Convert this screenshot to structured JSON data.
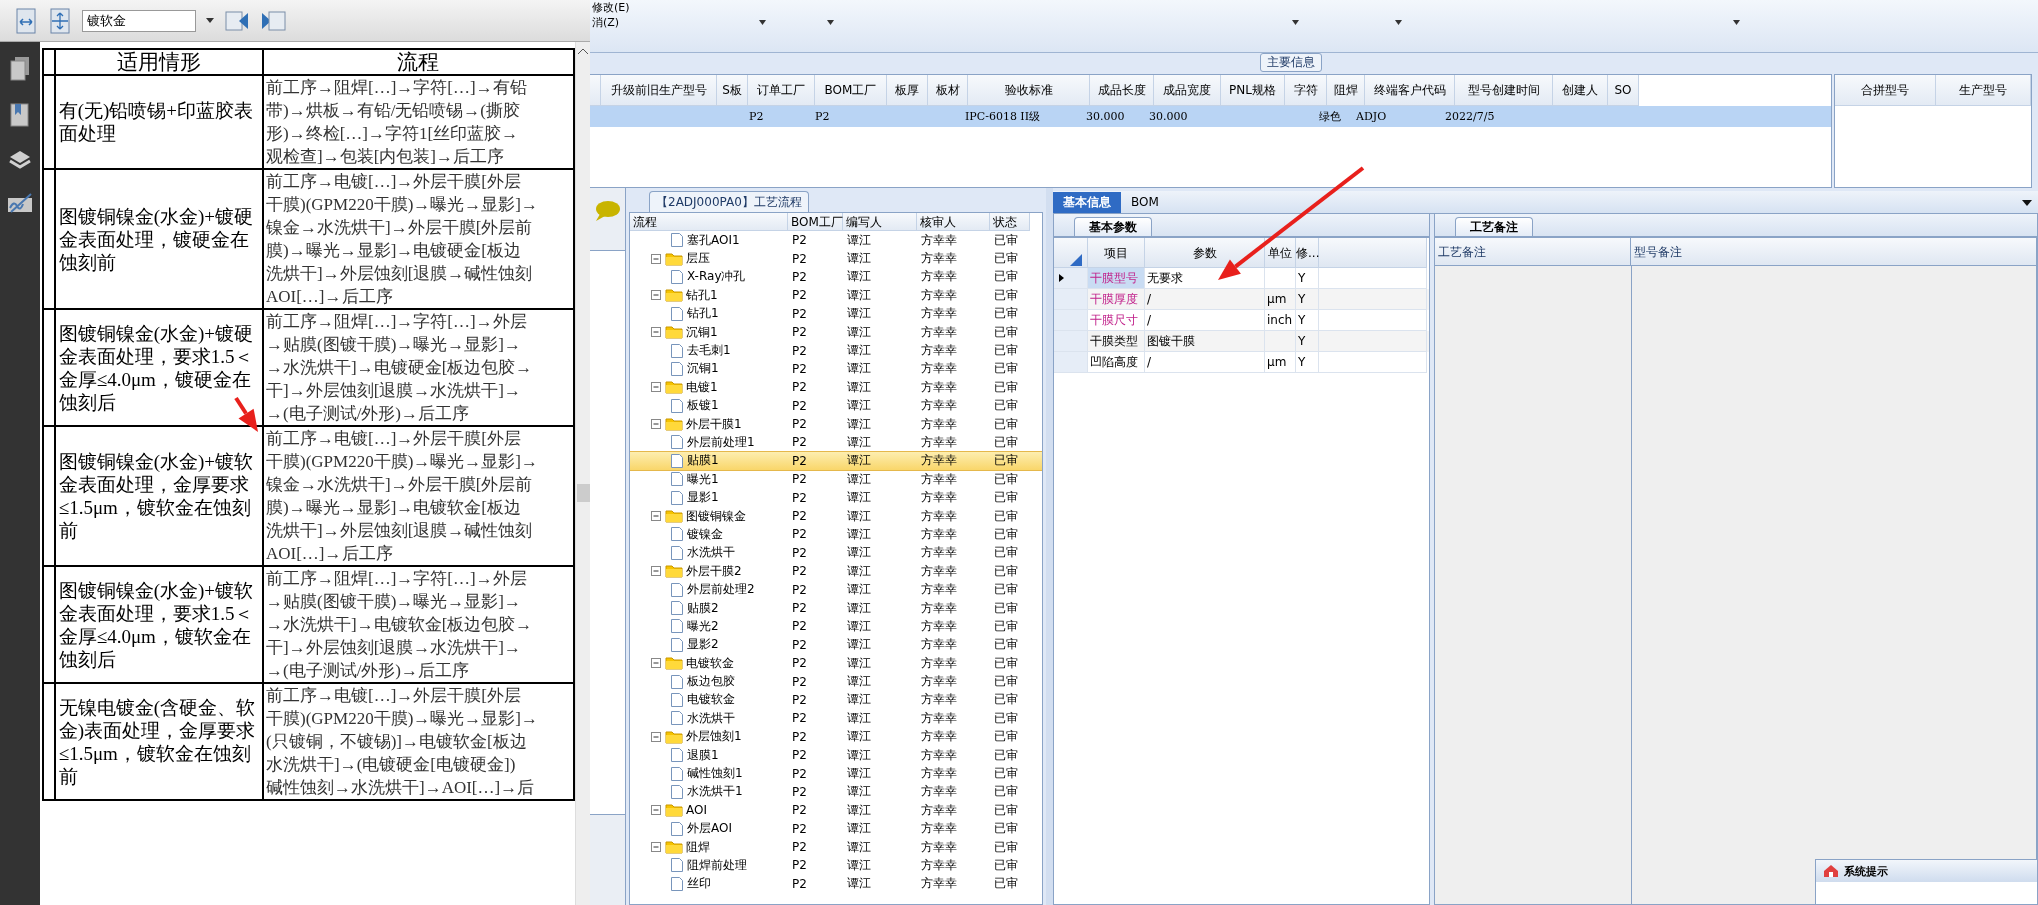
{
  "doc_viewer": {
    "zoom_field": {
      "value": "镀软金"
    },
    "table": {
      "columns": [
        "适用情形",
        "流程"
      ],
      "rows": [
        {
          "case": "有(无)铅喷锡+印蓝胶表面处理",
          "flow": [
            "前工序→阻焊[…]→字符[…]→有铅",
            "带)→烘板→有铅/无铅喷锡→(撕胶",
            "形)→终检[…]→字符1[丝印蓝胶→",
            "观检查]→包装[内包装]→后工序"
          ]
        },
        {
          "case": "图镀铜镍金(水金)+镀硬金表面处理，镀硬金在蚀刻前",
          "flow": [
            "前工序→电镀[…]→外层干膜[外层",
            "干膜)(GPM220干膜)→曝光→显影]→",
            "镍金→水洗烘干]→外层干膜[外层前",
            "膜)→曝光→显影]→电镀硬金[板边",
            "洗烘干]→外层蚀刻[退膜→碱性蚀刻",
            "AOI[…]→后工序"
          ]
        },
        {
          "case": "图镀铜镍金(水金)+镀硬金表面处理，要求1.5＜金厚≤4.0μm，镀硬金在蚀刻后",
          "flow": [
            "前工序→阻焊[…]→字符[…]→外层",
            "→贴膜(图镀干膜)→曝光→显影]→",
            "→水洗烘干]→电镀硬金[板边包胶→",
            "干]→外层蚀刻[退膜→水洗烘干]→",
            "→(电子测试/外形)→后工序"
          ]
        },
        {
          "case": "图镀铜镍金(水金)+镀软金表面处理，金厚要求≤1.5μm，镀软金在蚀刻前",
          "flow": [
            "前工序→电镀[…]→外层干膜[外层",
            "干膜)(GPM220干膜)→曝光→显影]→",
            "镍金→水洗烘干]→外层干膜[外层前",
            "膜)→曝光→显影]→电镀软金[板边",
            "洗烘干]→外层蚀刻[退膜→碱性蚀刻",
            "AOI[…]→后工序"
          ]
        },
        {
          "case": "图镀铜镍金(水金)+镀软金表面处理，要求1.5＜金厚≤4.0μm，镀软金在蚀刻后",
          "flow": [
            "前工序→阻焊[…]→字符[…]→外层",
            "→贴膜(图镀干膜)→曝光→显影]→",
            "→水洗烘干]→电镀软金[板边包胶→",
            "干]→外层蚀刻[退膜→水洗烘干]→",
            "→(电子测试/外形)→后工序"
          ]
        },
        {
          "case": "无镍电镀金(含硬金、软金)表面处理，金厚要求≤1.5μm，镀软金在蚀刻前",
          "flow": [
            "前工序→电镀[…]→外层干膜[外层",
            "干膜)(GPM220干膜)→曝光→显影]→",
            "(只镀铜，不镀锡)]→电镀软金[板边",
            "水洗烘干]→(电镀硬金[电镀硬金])",
            "碱性蚀刻→水洗烘干]→AOI[…]→后"
          ]
        }
      ]
    }
  },
  "menu": {
    "items": [
      "修改(E)",
      "消(Z)"
    ]
  },
  "main_info": {
    "title": "主要信息",
    "columns": [
      "升级前旧生产型号",
      "S板",
      "订单工厂",
      "BOM工厂",
      "板厚",
      "板材",
      "验收标准",
      "成品长度",
      "成品宽度",
      "PNL规格",
      "字符",
      "阻焊",
      "终端客户代码",
      "型号创建时间",
      "创建人",
      "SO"
    ],
    "rows": [
      {
        "selected": true,
        "cells": [
          {},
          {},
          {
            "text": "P2"
          },
          {
            "text": "P2"
          },
          {},
          {},
          {
            "text": "IPC-6018 II级"
          },
          {
            "text": "30.000"
          },
          {
            "text": "30.000"
          },
          {},
          {},
          {
            "text": "绿色"
          },
          {
            "text": "ADJO"
          },
          {
            "text": "2022/7/5"
          },
          {},
          {}
        ]
      }
    ],
    "side_columns": [
      "合拼型号",
      "生产型号"
    ]
  },
  "process_flow": {
    "title": "【2ADJ000PA0】工艺流程",
    "columns": [
      "流程",
      "BOM工厂",
      "编写人",
      "核审人",
      "状态"
    ],
    "tree": [
      {
        "label": "塞孔AOI1",
        "kind": "file",
        "selected": false,
        "cells": [
          "P2",
          "谭江",
          "方幸幸",
          "已审"
        ]
      },
      {
        "label": "层压",
        "kind": "folder",
        "expanded": true,
        "selected": false,
        "cells": [
          "P2",
          "谭江",
          "方幸幸",
          "已审"
        ],
        "children": [
          {
            "label": "X-Ray冲孔",
            "kind": "file",
            "selected": false,
            "cells": [
              "P2",
              "谭江",
              "方幸幸",
              "已审"
            ]
          }
        ]
      },
      {
        "label": "钻孔1",
        "kind": "folder",
        "expanded": true,
        "selected": false,
        "cells": [
          "P2",
          "谭江",
          "方幸幸",
          "已审"
        ],
        "children": [
          {
            "label": "钻孔1",
            "kind": "file",
            "selected": false,
            "cells": [
              "P2",
              "谭江",
              "方幸幸",
              "已审"
            ]
          }
        ]
      },
      {
        "label": "沉铜1",
        "kind": "folder",
        "expanded": true,
        "selected": false,
        "cells": [
          "P2",
          "谭江",
          "方幸幸",
          "已审"
        ],
        "children": [
          {
            "label": "去毛刺1",
            "kind": "file",
            "selected": false,
            "cells": [
              "P2",
              "谭江",
              "方幸幸",
              "已审"
            ]
          },
          {
            "label": "沉铜1",
            "kind": "file",
            "selected": false,
            "cells": [
              "P2",
              "谭江",
              "方幸幸",
              "已审"
            ]
          }
        ]
      },
      {
        "label": "电镀1",
        "kind": "folder",
        "expanded": true,
        "selected": false,
        "cells": [
          "P2",
          "谭江",
          "方幸幸",
          "已审"
        ],
        "children": [
          {
            "label": "板镀1",
            "kind": "file",
            "selected": false,
            "cells": [
              "P2",
              "谭江",
              "方幸幸",
              "已审"
            ]
          }
        ]
      },
      {
        "label": "外层干膜1",
        "kind": "folder",
        "expanded": true,
        "selected": false,
        "cells": [
          "P2",
          "谭江",
          "方幸幸",
          "已审"
        ],
        "children": [
          {
            "label": "外层前处理1",
            "kind": "file",
            "selected": false,
            "cells": [
              "P2",
              "谭江",
              "方幸幸",
              "已审"
            ]
          },
          {
            "label": "贴膜1",
            "kind": "file",
            "selected": true,
            "cells": [
              "P2",
              "谭江",
              "方幸幸",
              "已审"
            ]
          },
          {
            "label": "曝光1",
            "kind": "file",
            "selected": false,
            "cells": [
              "P2",
              "谭江",
              "方幸幸",
              "已审"
            ]
          },
          {
            "label": "显影1",
            "kind": "file",
            "selected": false,
            "cells": [
              "P2",
              "谭江",
              "方幸幸",
              "已审"
            ]
          }
        ]
      },
      {
        "label": "图镀铜镍金",
        "kind": "folder",
        "expanded": true,
        "selected": false,
        "cells": [
          "P2",
          "谭江",
          "方幸幸",
          "已审"
        ],
        "children": [
          {
            "label": "镀镍金",
            "kind": "file",
            "selected": false,
            "cells": [
              "P2",
              "谭江",
              "方幸幸",
              "已审"
            ]
          },
          {
            "label": "水洗烘干",
            "kind": "file",
            "selected": false,
            "cells": [
              "P2",
              "谭江",
              "方幸幸",
              "已审"
            ]
          }
        ]
      },
      {
        "label": "外层干膜2",
        "kind": "folder",
        "expanded": true,
        "selected": false,
        "cells": [
          "P2",
          "谭江",
          "方幸幸",
          "已审"
        ],
        "children": [
          {
            "label": "外层前处理2",
            "kind": "file",
            "selected": false,
            "cells": [
              "P2",
              "谭江",
              "方幸幸",
              "已审"
            ]
          },
          {
            "label": "贴膜2",
            "kind": "file",
            "selected": false,
            "cells": [
              "P2",
              "谭江",
              "方幸幸",
              "已审"
            ]
          },
          {
            "label": "曝光2",
            "kind": "file",
            "selected": false,
            "cells": [
              "P2",
              "谭江",
              "方幸幸",
              "已审"
            ]
          },
          {
            "label": "显影2",
            "kind": "file",
            "selected": false,
            "cells": [
              "P2",
              "谭江",
              "方幸幸",
              "已审"
            ]
          }
        ]
      },
      {
        "label": "电镀软金",
        "kind": "folder",
        "expanded": true,
        "selected": false,
        "cells": [
          "P2",
          "谭江",
          "方幸幸",
          "已审"
        ],
        "children": [
          {
            "label": "板边包胶",
            "kind": "file",
            "selected": false,
            "cells": [
              "P2",
              "谭江",
              "方幸幸",
              "已审"
            ]
          },
          {
            "label": "电镀软金",
            "kind": "file",
            "selected": false,
            "cells": [
              "P2",
              "谭江",
              "方幸幸",
              "已审"
            ]
          },
          {
            "label": "水洗烘干",
            "kind": "file",
            "selected": false,
            "cells": [
              "P2",
              "谭江",
              "方幸幸",
              "已审"
            ]
          }
        ]
      },
      {
        "label": "外层蚀刻1",
        "kind": "folder",
        "expanded": true,
        "selected": false,
        "cells": [
          "P2",
          "谭江",
          "方幸幸",
          "已审"
        ],
        "children": [
          {
            "label": "退膜1",
            "kind": "file",
            "selected": false,
            "cells": [
              "P2",
              "谭江",
              "方幸幸",
              "已审"
            ]
          },
          {
            "label": "碱性蚀刻1",
            "kind": "file",
            "selected": false,
            "cells": [
              "P2",
              "谭江",
              "方幸幸",
              "已审"
            ]
          },
          {
            "label": "水洗烘干1",
            "kind": "file",
            "selected": false,
            "cells": [
              "P2",
              "谭江",
              "方幸幸",
              "已审"
            ]
          }
        ]
      },
      {
        "label": "AOI",
        "kind": "folder",
        "expanded": true,
        "selected": false,
        "cells": [
          "P2",
          "谭江",
          "方幸幸",
          "已审"
        ],
        "children": [
          {
            "label": "外层AOI",
            "kind": "file",
            "selected": false,
            "cells": [
              "P2",
              "谭江",
              "方幸幸",
              "已审"
            ]
          }
        ]
      },
      {
        "label": "阻焊",
        "kind": "folder",
        "expanded": true,
        "selected": false,
        "cells": [
          "P2",
          "谭江",
          "方幸幸",
          "已审"
        ],
        "children": [
          {
            "label": "阻焊前处理",
            "kind": "file",
            "selected": false,
            "cells": [
              "P2",
              "谭江",
              "方幸幸",
              "已审"
            ]
          },
          {
            "label": "丝印",
            "kind": "file",
            "selected": false,
            "cells": [
              "P2",
              "谭江",
              "方幸幸",
              "已审"
            ]
          }
        ]
      }
    ]
  },
  "detail_tabs": [
    {
      "label": "基本信息",
      "selected": true
    },
    {
      "label": "BOM",
      "selected": false
    }
  ],
  "params": {
    "tab": "基本参数",
    "columns": [
      "项目",
      "参数",
      "单位",
      "修..."
    ],
    "rows": [
      {
        "item": "干膜型号",
        "value": "无要求",
        "modifiable": "Y",
        "marked": true,
        "selected": true
      },
      {
        "item": "干膜厚度",
        "value": "/",
        "unit": "μm",
        "modifiable": "Y",
        "marked": true,
        "selected": false
      },
      {
        "item": "干膜尺寸",
        "value": "/",
        "unit": "inch",
        "modifiable": "Y",
        "marked": true,
        "selected": false
      },
      {
        "item": "干膜类型",
        "value": "图镀干膜",
        "modifiable": "Y",
        "marked": false,
        "selected": false
      },
      {
        "item": "凹陷高度",
        "value": "/",
        "unit": "μm",
        "modifiable": "Y",
        "marked": false,
        "selected": false
      }
    ]
  },
  "remarks": {
    "tab": "工艺备注",
    "columns": [
      "工艺备注",
      "型号备注"
    ]
  },
  "popup": {
    "title": "系统提示"
  }
}
